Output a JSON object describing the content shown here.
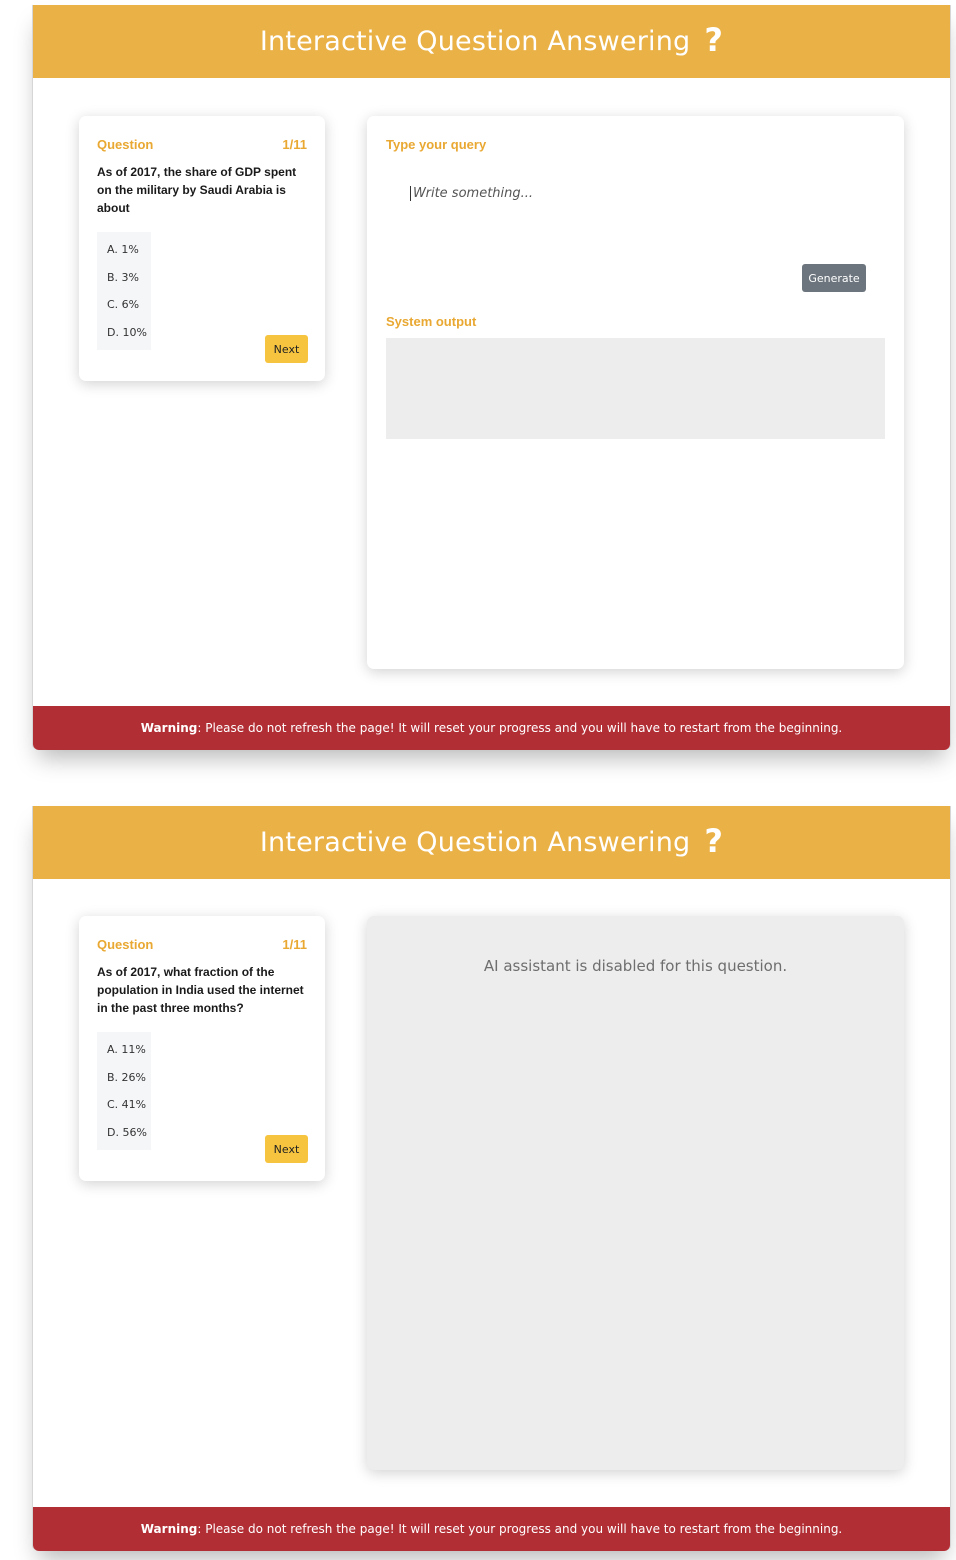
{
  "app": {
    "title": "Interactive Question Answering",
    "title_icon": "question-mark-icon",
    "title_icon_glyph": "?",
    "accent_color": "#eab146",
    "warning_color": "#b22e35"
  },
  "warning": {
    "label": "Warning",
    "text": ": Please do not refresh the page! It will reset your progress and you will have to restart from the beginning."
  },
  "screen1": {
    "question": {
      "label": "Question",
      "counter": "1/11",
      "text": "As of 2017, the share of GDP spent on the military by Saudi Arabia is about",
      "options": [
        "A. 1%",
        "B. 3%",
        "C. 6%",
        "D. 10%"
      ],
      "next_label": "Next"
    },
    "query": {
      "label": "Type your query",
      "placeholder": "Write something...",
      "generate_label": "Generate",
      "output_label": "System output"
    }
  },
  "screen2": {
    "question": {
      "label": "Question",
      "counter": "1/11",
      "text": "As of 2017, what fraction of the population in India used the internet in the past three months?",
      "options": [
        "A. 11%",
        "B. 26%",
        "C. 41%",
        "D. 56%"
      ],
      "next_label": "Next"
    },
    "assistant": {
      "disabled_text": "AI assistant is disabled for this question."
    }
  }
}
